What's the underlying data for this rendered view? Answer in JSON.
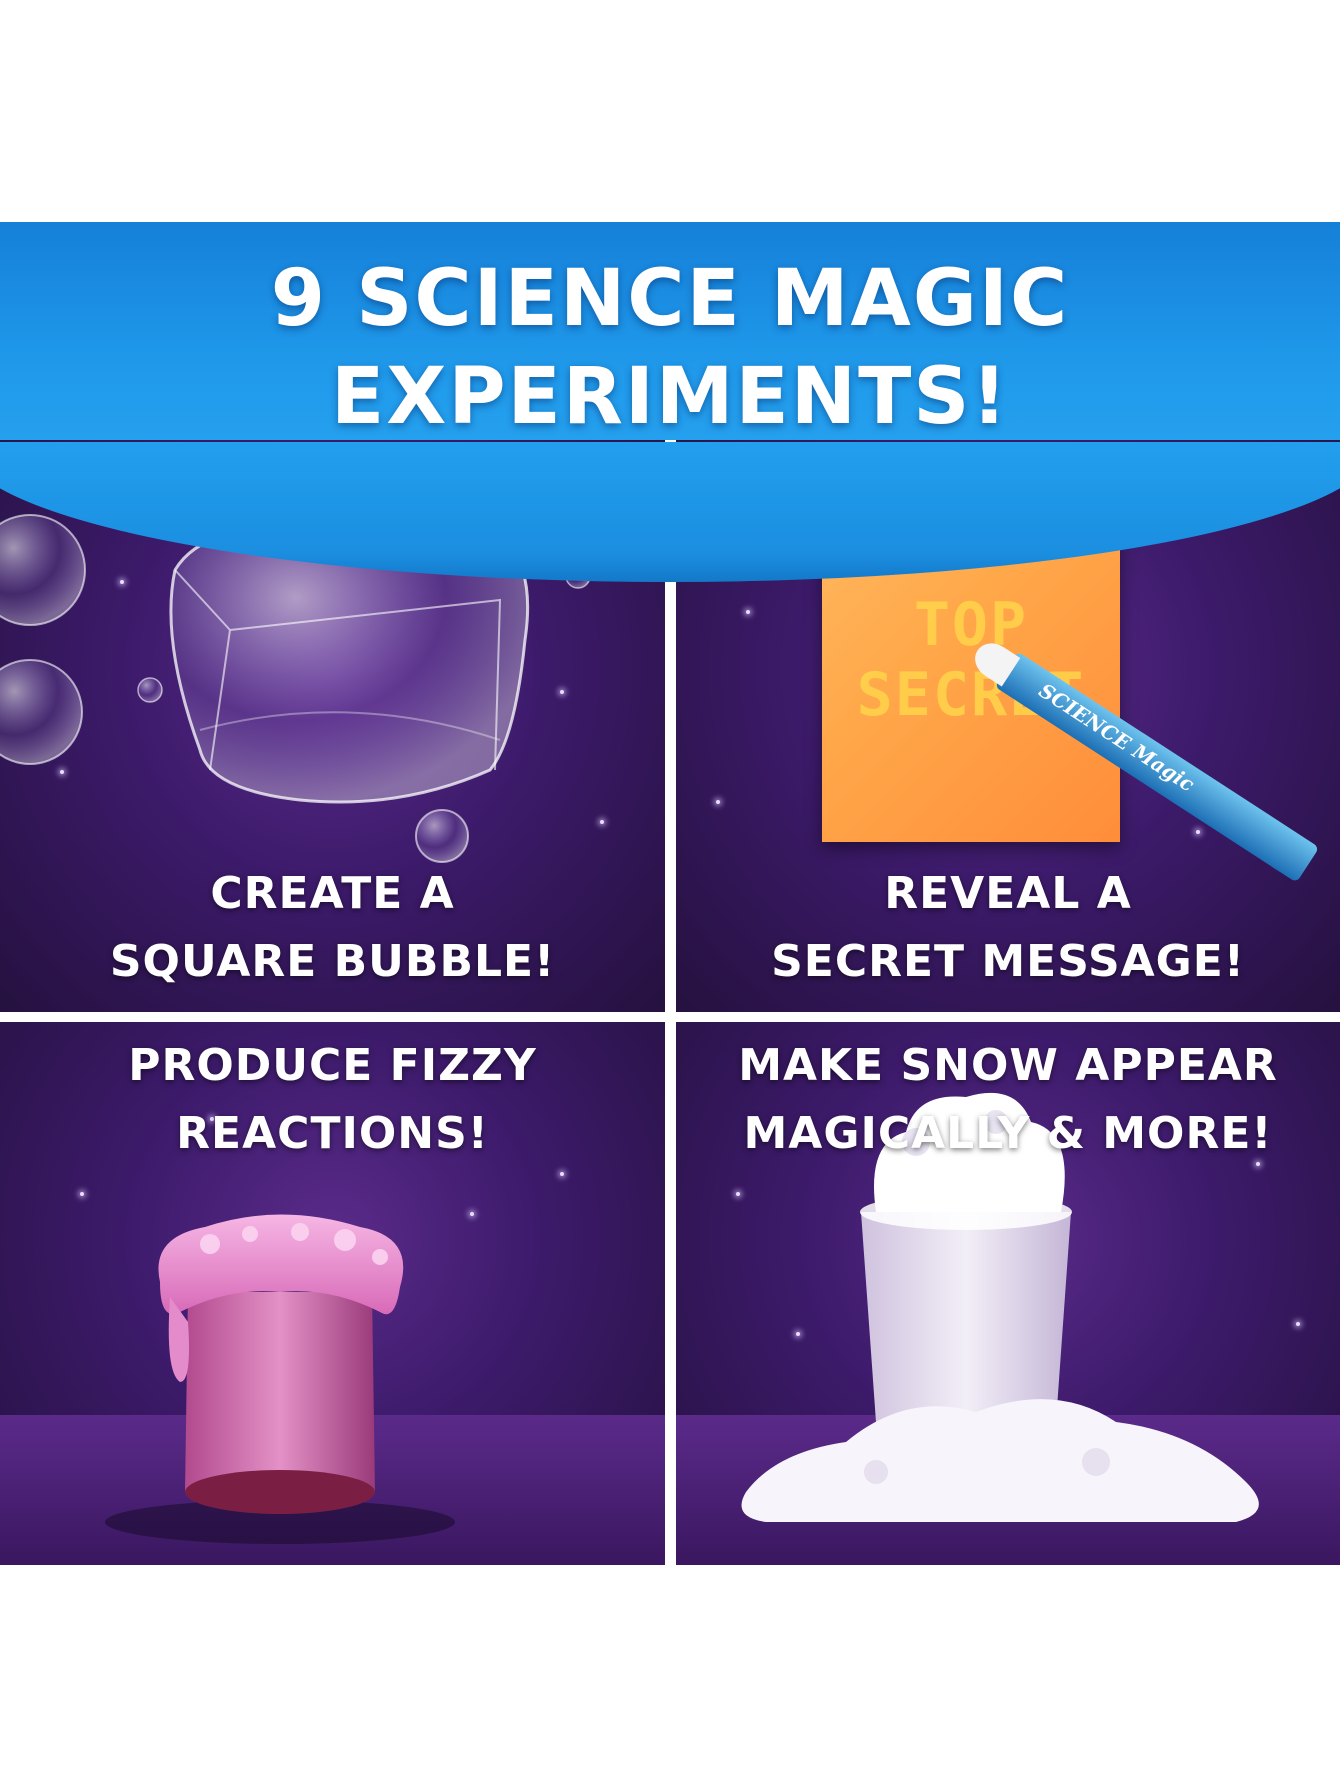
{
  "headline": {
    "line1": "9 SCIENCE MAGIC",
    "line2": "EXPERIMENTS!"
  },
  "panels": [
    {
      "caption_line1": "CREATE A",
      "caption_line2": "SQUARE BUBBLE!",
      "image": "square-bubble"
    },
    {
      "caption_line1": "REVEAL A",
      "caption_line2": "SECRET MESSAGE!",
      "image": "secret-note",
      "note_line1": "TOP",
      "note_line2": "SECRET",
      "pen_label": "SCIENCE Magic"
    },
    {
      "caption_line1": "PRODUCE FIZZY",
      "caption_line2": "REACTIONS!",
      "image": "fizzy-cup"
    },
    {
      "caption_line1": "MAKE SNOW APPEAR",
      "caption_line2": "MAGICALLY & MORE!",
      "image": "snow-cup"
    }
  ],
  "colors": {
    "banner": "#1f98ea",
    "panel": "#3c1a6a",
    "note": "#ffa84a",
    "foam": "#e98ad0"
  }
}
